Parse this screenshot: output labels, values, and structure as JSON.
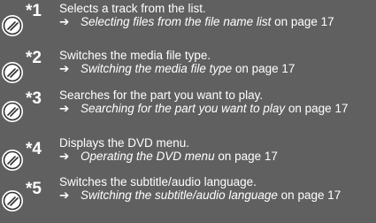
{
  "items": [
    {
      "marker": "*1",
      "description": "Selects a track from the list.",
      "ref_arrow": "➔",
      "ref_title": "Selecting files from the file name list",
      "ref_suffix": " on page 17"
    },
    {
      "marker": "*2",
      "description": "Switches the media file type.",
      "ref_arrow": "➔",
      "ref_title": "Switching the media file type",
      "ref_suffix": " on page 17"
    },
    {
      "marker": "*3",
      "description": "Searches for the part you want to play.",
      "ref_arrow": "➔",
      "ref_title": "Searching for the part you want to play",
      "ref_suffix": " on page 17"
    },
    {
      "marker": "*4",
      "description": "Displays the DVD menu.",
      "ref_arrow": "➔",
      "ref_title": "Operating the DVD menu",
      "ref_suffix": " on page 17"
    },
    {
      "marker": "*5",
      "description": "Switches the subtitle/audio language.",
      "ref_arrow": "➔",
      "ref_title": "Switching the subtitle/audio language",
      "ref_suffix": " on page 17"
    }
  ],
  "icon": "touch-key-icon",
  "colors": {
    "background": "#606060",
    "text": "#ffffff"
  }
}
